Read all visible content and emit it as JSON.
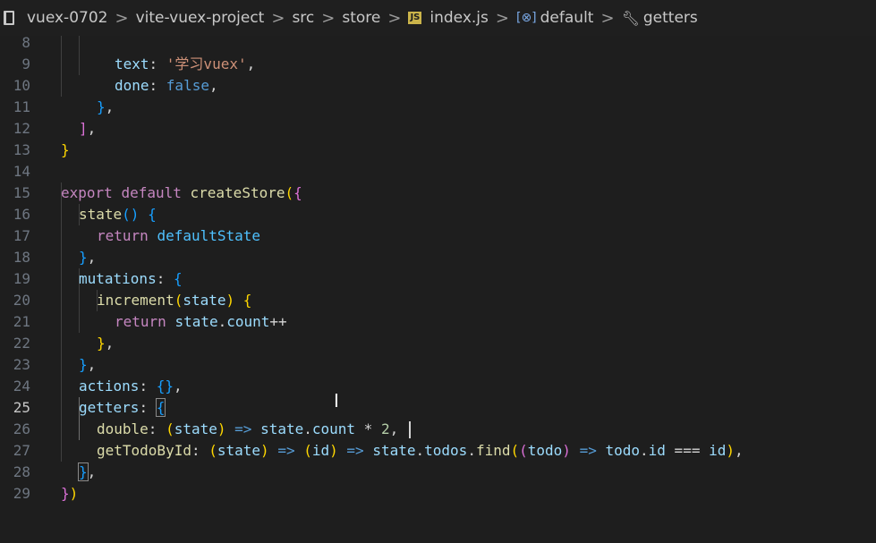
{
  "breadcrumb": {
    "items": [
      "vuex-0702",
      "vite-vuex-project",
      "src",
      "store",
      "index.js",
      "default",
      "getters"
    ],
    "separator": ">",
    "js_badge": "JS",
    "symbol_badge": "[⊗]"
  },
  "editor": {
    "active_line": "25",
    "lines": {
      "l8": {
        "num": "8",
        "t": [
          "text",
          ": ",
          "'学习vuex'",
          ","
        ]
      },
      "l9": {
        "num": "9",
        "t": [
          "done",
          ": ",
          "false",
          ","
        ]
      },
      "l10": {
        "num": "10",
        "t": [
          "}",
          ","
        ]
      },
      "l11": {
        "num": "11",
        "t": [
          "]",
          ","
        ]
      },
      "l12": {
        "num": "12",
        "t": [
          "}"
        ]
      },
      "l13": {
        "num": "13",
        "t": []
      },
      "l14": {
        "num": "14",
        "t": [
          "export",
          " ",
          "default",
          " ",
          "createStore",
          "(",
          "{"
        ]
      },
      "l15": {
        "num": "15",
        "t": [
          "state",
          "()",
          " ",
          "{"
        ]
      },
      "l16": {
        "num": "16",
        "t": [
          "return",
          " ",
          "defaultState"
        ]
      },
      "l17": {
        "num": "17",
        "t": [
          "}",
          ","
        ]
      },
      "l18": {
        "num": "18",
        "t": [
          "mutations",
          ": ",
          "{"
        ]
      },
      "l19": {
        "num": "19",
        "t": [
          "increment",
          "(",
          "state",
          ")",
          " ",
          "{"
        ]
      },
      "l20": {
        "num": "20",
        "t": [
          "return",
          " ",
          "state",
          ".",
          "count",
          "++"
        ]
      },
      "l21": {
        "num": "21",
        "t": [
          "}",
          ","
        ]
      },
      "l22": {
        "num": "22",
        "t": [
          "}",
          ","
        ]
      },
      "l23": {
        "num": "23",
        "t": [
          "actions",
          ": ",
          "{}",
          ","
        ]
      },
      "l24": {
        "num": "24",
        "t": [
          "getters",
          ": ",
          "{"
        ]
      },
      "l25": {
        "num": "25",
        "t": [
          "double",
          ": ",
          "(",
          "state",
          ")",
          " ",
          "=>",
          " ",
          "state",
          ".",
          "count",
          " * ",
          "2",
          ", "
        ]
      },
      "l26": {
        "num": "26",
        "t": [
          "getTodoById",
          ": ",
          "(",
          "state",
          ")",
          " ",
          "=>",
          " ",
          "(",
          "id",
          ")",
          " ",
          "=>",
          " ",
          "state",
          ".",
          "todos",
          ".",
          "find",
          "(",
          "(",
          "todo",
          ")",
          " ",
          "=>",
          " ",
          "todo",
          ".",
          "id",
          " === ",
          "id",
          ")",
          ","
        ]
      },
      "l27": {
        "num": "27",
        "t": [
          "}",
          ","
        ]
      },
      "l28": {
        "num": "28",
        "t": [
          "}",
          ")"
        ]
      },
      "l29": {
        "num": "29",
        "t": []
      }
    }
  },
  "colors": {
    "background": "#1e1e1e",
    "keyword": "#569cd6",
    "control": "#c586c0",
    "function": "#dcdcaa",
    "property": "#9cdcfe",
    "bracket_1": "#ffd700",
    "bracket_2": "#da70d6",
    "bracket_3": "#179fff"
  },
  "icons": {
    "explorer": "book-icon",
    "file": "js-file-icon",
    "symbol": "symbol-variable-icon",
    "getters": "wrench-icon",
    "mouse": "text-cursor-icon"
  }
}
